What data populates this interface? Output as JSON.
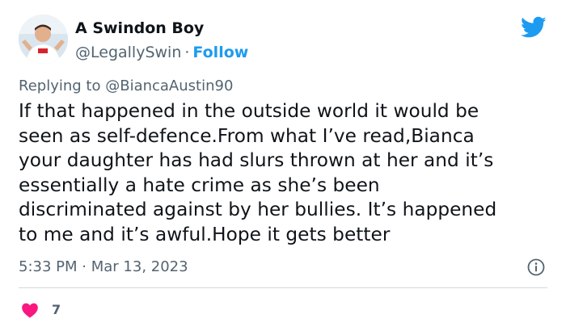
{
  "author": {
    "display_name": "A Swindon Boy",
    "handle": "@LegallySwin",
    "separator": "·",
    "follow_label": "Follow",
    "avatar_icon": "person-avatar-icon"
  },
  "brand": {
    "icon": "twitter-bird-icon",
    "color": "#1d9bf0"
  },
  "reply": {
    "prefix": "Replying to",
    "mention": "@BiancaAustin90"
  },
  "tweet": {
    "text": "If that happened in the outside world it would be\nseen as self-defence.From what I’ve read,Bianca\nyour daughter has had slurs thrown at her and it’s\nessentially a hate crime as she’s been\ndiscriminated against by her bullies. It’s happened\nto me and it’s awful.Hope it gets better"
  },
  "meta": {
    "time": "5:33 PM",
    "separator": "·",
    "date": "Mar 13, 2023",
    "info_icon": "info-icon"
  },
  "engagement": {
    "like_icon": "heart-icon",
    "like_color": "#f91880",
    "like_count": "7"
  },
  "colors": {
    "text_primary": "#0f1419",
    "text_secondary": "#536471",
    "link": "#1d9bf0",
    "divider": "#cfd9de"
  }
}
